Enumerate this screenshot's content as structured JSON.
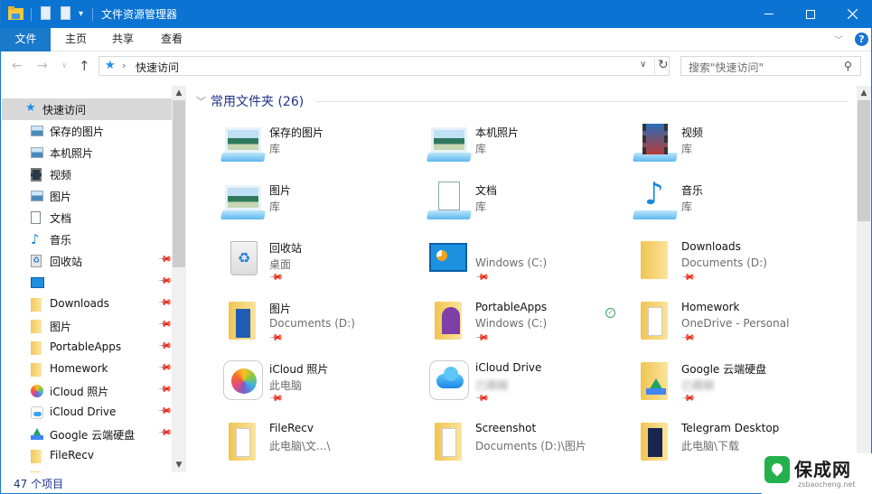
{
  "window": {
    "title": "文件资源管理器",
    "controls": {
      "minimize": "minimize",
      "maximize": "maximize",
      "close": "close"
    }
  },
  "ribbon": {
    "tabs": [
      {
        "label": "文件",
        "active": true
      },
      {
        "label": "主页"
      },
      {
        "label": "共享"
      },
      {
        "label": "查看"
      }
    ],
    "expand_icon": "chevron-down-icon",
    "help_label": "?"
  },
  "navigation": {
    "back": "←",
    "forward": "→",
    "recent": "˅",
    "up": "↑",
    "address": {
      "icon": "quick-access-star-icon",
      "separator": "›",
      "path": "快速访问"
    },
    "search": {
      "placeholder": "搜索\"快速访问\""
    }
  },
  "sidebar": {
    "root": {
      "label": "快速访问",
      "icon": "star-icon"
    },
    "items": [
      {
        "label": "保存的图片",
        "icon": "library-pictures-icon",
        "pinned": false
      },
      {
        "label": "本机照片",
        "icon": "library-pictures-icon",
        "pinned": false
      },
      {
        "label": "视频",
        "icon": "library-videos-icon",
        "pinned": false
      },
      {
        "label": "图片",
        "icon": "library-pictures-icon",
        "pinned": false
      },
      {
        "label": "文档",
        "icon": "library-documents-icon",
        "pinned": false
      },
      {
        "label": "音乐",
        "icon": "library-music-icon",
        "pinned": false
      },
      {
        "label": "回收站",
        "icon": "recycle-bin-icon",
        "pinned": true
      },
      {
        "label": "",
        "icon": "control-panel-icon",
        "pinned": true
      },
      {
        "label": "Downloads",
        "icon": "folder-icon",
        "pinned": true
      },
      {
        "label": "图片",
        "icon": "folder-icon",
        "pinned": true
      },
      {
        "label": "PortableApps",
        "icon": "folder-icon",
        "pinned": true
      },
      {
        "label": "Homework",
        "icon": "folder-icon",
        "pinned": true
      },
      {
        "label": "iCloud 照片",
        "icon": "icloud-photos-icon",
        "pinned": true
      },
      {
        "label": "iCloud Drive",
        "icon": "icloud-drive-icon",
        "pinned": true
      },
      {
        "label": "Google 云端硬盘",
        "icon": "google-drive-icon",
        "pinned": true
      },
      {
        "label": "FileRecv",
        "icon": "folder-icon",
        "pinned": false
      }
    ]
  },
  "content": {
    "group": {
      "title": "常用文件夹 (26)"
    },
    "tiles": [
      {
        "name": "保存的图片",
        "sub": "库",
        "icon": "library-pictures-icon",
        "pinned": false
      },
      {
        "name": "本机照片",
        "sub": "库",
        "icon": "library-pictures-icon",
        "pinned": false
      },
      {
        "name": "视频",
        "sub": "库",
        "icon": "library-videos-icon",
        "pinned": false
      },
      {
        "name": "图片",
        "sub": "库",
        "icon": "library-pictures-icon",
        "pinned": false
      },
      {
        "name": "文档",
        "sub": "库",
        "icon": "library-documents-icon",
        "pinned": false
      },
      {
        "name": "音乐",
        "sub": "库",
        "icon": "library-music-icon",
        "pinned": false
      },
      {
        "name": "回收站",
        "sub": "桌面",
        "icon": "recycle-bin-icon",
        "pinned": true
      },
      {
        "name": "",
        "sub": "Windows (C:)",
        "icon": "control-panel-icon",
        "pinned": true
      },
      {
        "name": "Downloads",
        "sub": "Documents (D:)",
        "icon": "folder-icon",
        "pinned": true
      },
      {
        "name": "图片",
        "sub": "Documents (D:)",
        "icon": "folder-pictures-icon",
        "pinned": true
      },
      {
        "name": "PortableApps",
        "sub": "Windows (C:)",
        "icon": "folder-portableapps-icon",
        "pinned": true
      },
      {
        "name": "Homework",
        "sub": "OneDrive - Personal",
        "icon": "folder-documents-icon",
        "pinned": true,
        "sync_status": "synced"
      },
      {
        "name": "iCloud 照片",
        "sub": "此电脑",
        "icon": "icloud-photos-icon",
        "pinned": true
      },
      {
        "name": "iCloud Drive",
        "sub": "已模糊",
        "icon": "icloud-drive-icon",
        "pinned": true,
        "sub_blurred": true
      },
      {
        "name": "Google 云端硬盘",
        "sub": "已模糊",
        "icon": "google-drive-icon",
        "pinned": true,
        "sub_blurred": true
      },
      {
        "name": "FileRecv",
        "sub": "此电脑\\文...\\",
        "icon": "folder-documents-icon",
        "pinned": false
      },
      {
        "name": "Screenshot",
        "sub": "Documents (D:)\\图片",
        "icon": "folder-documents-icon",
        "pinned": false
      },
      {
        "name": "Telegram Desktop",
        "sub": "此电脑\\下载",
        "icon": "folder-telegram-icon",
        "pinned": false
      }
    ]
  },
  "status": {
    "item_count": "47 个项目"
  },
  "watermark": {
    "title": "保成网",
    "url": "zsbaocheng.net"
  },
  "colors": {
    "accent": "#0b73d2",
    "selected": "#d9d9d9",
    "group_title": "#1e3287"
  }
}
